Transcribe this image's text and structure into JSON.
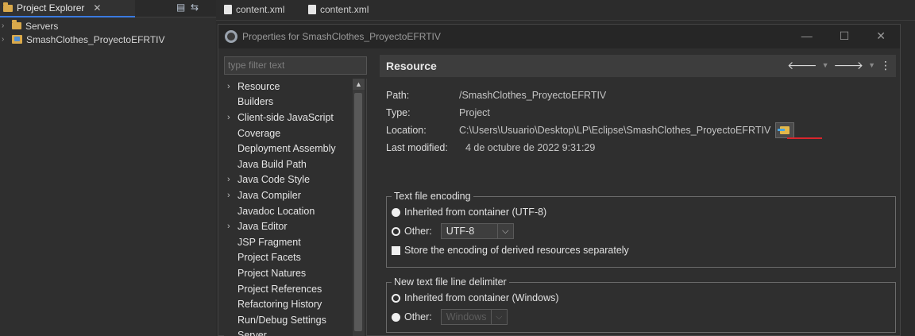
{
  "explorer": {
    "tab_label": "Project Explorer",
    "close_glyph": "✕",
    "items": [
      {
        "label": "Servers",
        "icon": "folder-icon"
      },
      {
        "label": "SmashClothes_ProyectoEFRTIV",
        "icon": "project-icon"
      }
    ]
  },
  "editor_tabs": [
    "content.xml",
    "content.xml"
  ],
  "dialog": {
    "title": "Properties for SmashClothes_ProyectoEFRTIV",
    "window_buttons": {
      "minimize": "—",
      "maximize": "☐",
      "close": "✕"
    },
    "filter_placeholder": "type filter text",
    "categories": [
      {
        "label": "Resource",
        "expandable": true
      },
      {
        "label": "Builders",
        "expandable": false
      },
      {
        "label": "Client-side JavaScript",
        "expandable": true
      },
      {
        "label": "Coverage",
        "expandable": false
      },
      {
        "label": "Deployment Assembly",
        "expandable": false
      },
      {
        "label": "Java Build Path",
        "expandable": false
      },
      {
        "label": "Java Code Style",
        "expandable": true
      },
      {
        "label": "Java Compiler",
        "expandable": true
      },
      {
        "label": "Javadoc Location",
        "expandable": false
      },
      {
        "label": "Java Editor",
        "expandable": true
      },
      {
        "label": "JSP Fragment",
        "expandable": false
      },
      {
        "label": "Project Facets",
        "expandable": false
      },
      {
        "label": "Project Natures",
        "expandable": false
      },
      {
        "label": "Project References",
        "expandable": false
      },
      {
        "label": "Refactoring History",
        "expandable": false
      },
      {
        "label": "Run/Debug Settings",
        "expandable": false
      },
      {
        "label": "Server",
        "expandable": false
      }
    ],
    "panel": {
      "title": "Resource",
      "path_label": "Path:",
      "path_value": "/SmashClothes_ProyectoEFRTIV",
      "type_label": "Type:",
      "type_value": "Project",
      "location_label": "Location:",
      "location_value": "C:\\Users\\Usuario\\Desktop\\LP\\Eclipse\\SmashClothes_ProyectoEFRTIV",
      "modified_label": "Last modified:",
      "modified_value": "4 de octubre de 2022 9:31:29",
      "encoding_group": "Text file encoding",
      "encoding_inherited": "Inherited from container (UTF-8)",
      "encoding_other": "Other:",
      "encoding_value": "UTF-8",
      "encoding_store": "Store the encoding of derived resources separately",
      "delimiter_group": "New text file line delimiter",
      "delimiter_inherited": "Inherited from container (Windows)",
      "delimiter_other": "Other:",
      "delimiter_value": "Windows"
    }
  },
  "colors": {
    "accent": "#3a7ae0",
    "highlight": "#d9262c",
    "folder": "#d9a94b"
  }
}
